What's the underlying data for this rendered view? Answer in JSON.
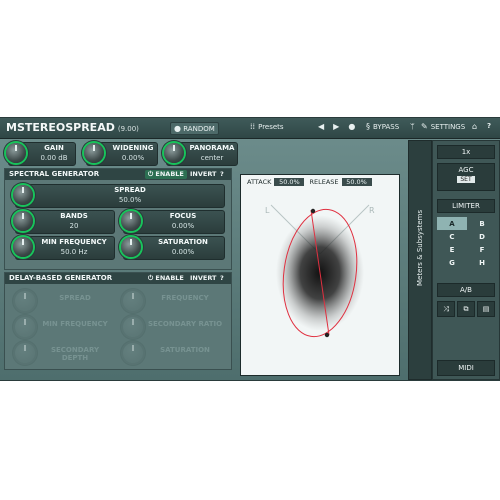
{
  "header": {
    "title": "MSTEREOSPREAD",
    "version": "(9.00)",
    "random_label": "RANDOM",
    "presets_label": "Presets",
    "bypass_label": "BYPASS",
    "settings_label": "SETTINGS",
    "help_label": "?"
  },
  "top_params": [
    {
      "label": "GAIN",
      "value": "0.00 dB"
    },
    {
      "label": "WIDENING",
      "value": "0.00%"
    },
    {
      "label": "PANORAMA",
      "value": "center"
    }
  ],
  "spectral": {
    "title": "SPECTRAL GENERATOR",
    "enable_label": "ENABLE",
    "invert_label": "INVERT",
    "help_label": "?",
    "spread": {
      "label": "SPREAD",
      "value": "50.0%"
    },
    "bands": {
      "label": "BANDS",
      "value": "20"
    },
    "focus": {
      "label": "FOCUS",
      "value": "0.00%"
    },
    "min_freq": {
      "label": "MIN FREQUENCY",
      "value": "50.0 Hz"
    },
    "saturation": {
      "label": "SATURATION",
      "value": "0.00%"
    }
  },
  "delay": {
    "title": "DELAY-BASED GENERATOR",
    "enable_label": "ENABLE",
    "invert_label": "INVERT",
    "help_label": "?",
    "labels": [
      "SPREAD",
      "FREQUENCY",
      "MIN FREQUENCY",
      "SECONDARY RATIO",
      "SECONDARY DEPTH",
      "SATURATION"
    ]
  },
  "scope": {
    "attack_label": "ATTACK",
    "attack_value": "50.0%",
    "release_label": "RELEASE",
    "release_value": "50.0%",
    "left_label": "L",
    "right_label": "R"
  },
  "sidebar": {
    "label": "Meters & Subsystems"
  },
  "right_panel": {
    "zoom": "1x",
    "agc": "AGC",
    "set": "SET",
    "limiter": "LIMITER",
    "presets": [
      "A",
      "B",
      "C",
      "D",
      "E",
      "F",
      "G",
      "H"
    ],
    "ab": "A/B",
    "midi": "MIDI"
  },
  "colors": {
    "accent_green": "#18c35b",
    "ellipse_red": "#e03040"
  }
}
